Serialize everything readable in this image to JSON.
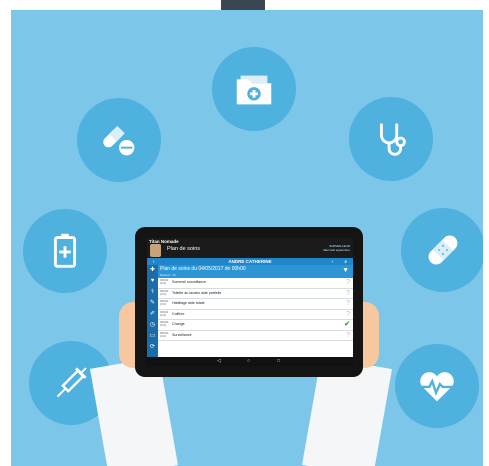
{
  "app": {
    "name": "Titan Nomade",
    "section": "Plan de soins",
    "user_label": "SURVEILLEUR",
    "subinfo": "Mercredi septembre"
  },
  "patient": {
    "name": "ANDRE CATHERINE"
  },
  "icons": {
    "prev": "‹",
    "next": "›",
    "search": "⌕",
    "filter": "▼"
  },
  "plan": {
    "title": "Plan de soins du 04/05/2017 de 00h00",
    "subtitle": "Médecin : Dr"
  },
  "side": [
    "✚",
    "♥",
    "⚕",
    "✎",
    "✐",
    "◷",
    "▭",
    "⟳"
  ],
  "rows": [
    {
      "time": "00h00 (0.0)",
      "label": "Sommeil surveillance",
      "status": "?"
    },
    {
      "time": "00h00 (0.0)",
      "label": "Toilette au lavabo aide partielle",
      "status": "?"
    },
    {
      "time": "00h00 (0.0)",
      "label": "Habillage aide totale",
      "status": "?"
    },
    {
      "time": "00h00 (0.0)",
      "label": "Coiffure",
      "status": "?"
    },
    {
      "time": "00h00 (0.0)",
      "label": "Change",
      "status": "✔"
    },
    {
      "time": "00h00 (0.0)",
      "label": "Surveillance",
      "status": "?"
    }
  ],
  "nav": {
    "back": "◁",
    "home": "○",
    "recent": "□"
  },
  "colors": {
    "background": "#7cc6ea",
    "bubble": "#4fb1de",
    "accent": "#1f87c9"
  }
}
